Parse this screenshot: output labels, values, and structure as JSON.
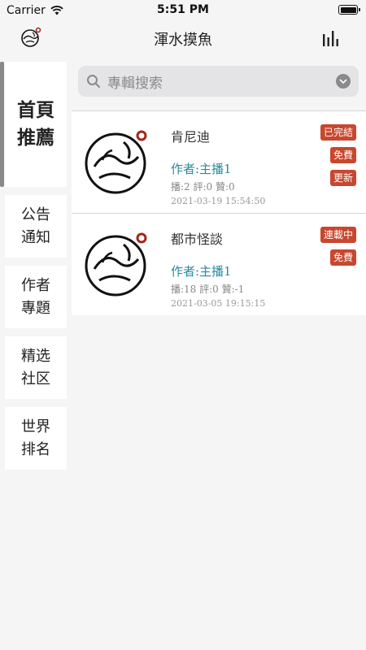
{
  "status_bar": {
    "carrier": "Carrier",
    "time": "5:51 PM"
  },
  "nav": {
    "title": "渾水摸魚",
    "logo_icon": "fish-logo-icon",
    "right_icon": "bar-chart-icon"
  },
  "sidebar": {
    "items": [
      {
        "line1": "首頁",
        "line2": "推薦",
        "active": true
      },
      {
        "line1": "公告",
        "line2": "通知",
        "active": false
      },
      {
        "line1": "作者",
        "line2": "專題",
        "active": false
      },
      {
        "line1": "精选",
        "line2": "社区",
        "active": false
      },
      {
        "line1": "世界",
        "line2": "排名",
        "active": false
      }
    ]
  },
  "search": {
    "placeholder": "專輯搜索"
  },
  "albums": [
    {
      "title": "肯尼迪",
      "author": "作者:主播1",
      "stats": "播:2  評:0  贊:0",
      "date": "2021-03-19 15:54:50",
      "tags": [
        "已完結",
        "免費",
        "更新"
      ]
    },
    {
      "title": "都市怪談",
      "author": "作者:主播1",
      "stats": "播:18  評:0  贊:-1",
      "date": "2021-03-05 19:15:15",
      "tags": [
        "連載中",
        "免費"
      ]
    }
  ],
  "colors": {
    "tag": "#c8472e",
    "author": "#2a8a9a",
    "logo_dot": "#a0281a"
  }
}
